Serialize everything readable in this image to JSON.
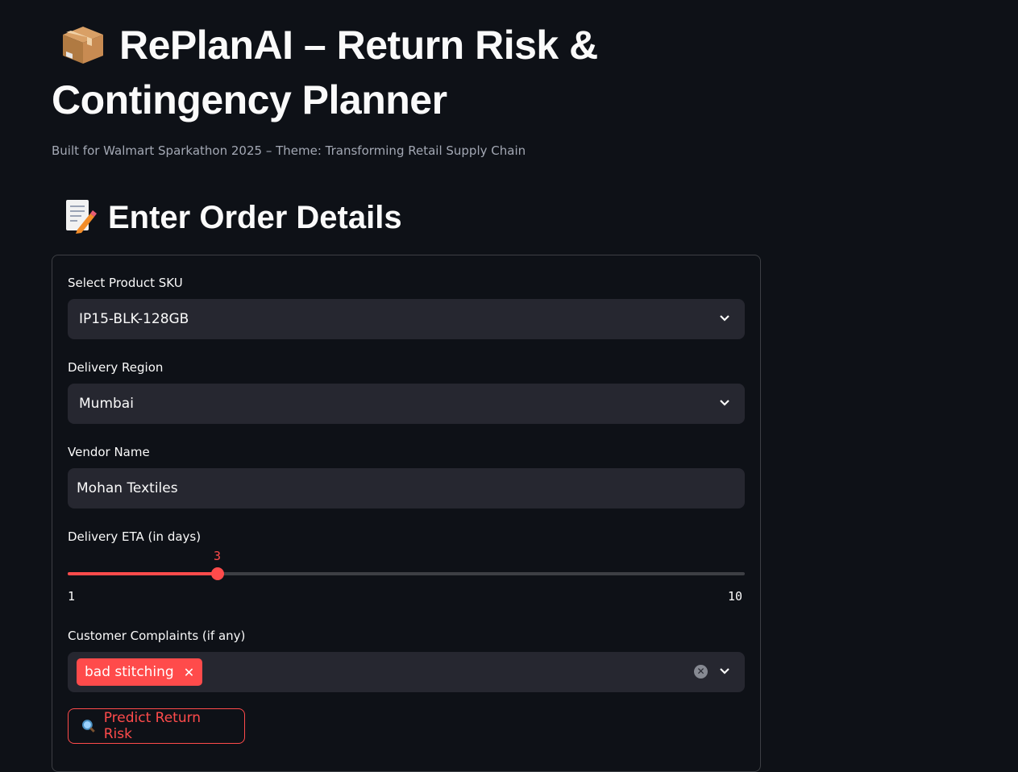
{
  "header": {
    "title": "RePlanAI – Return Risk & Contingency Planner",
    "title_icon": "package-icon",
    "caption": "Built for Walmart Sparkathon 2025 – Theme: Transforming Retail Supply Chain"
  },
  "section": {
    "heading": "Enter Order Details",
    "heading_icon": "memo-icon"
  },
  "form": {
    "sku_label": "Select Product SKU",
    "sku_value": "IP15-BLK-128GB",
    "region_label": "Delivery Region",
    "region_value": "Mumbai",
    "vendor_label": "Vendor Name",
    "vendor_value": "Mohan Textiles",
    "eta_label": "Delivery ETA (in days)",
    "eta_value": "3",
    "eta_min": "1",
    "eta_max": "10",
    "complaints_label": "Customer Complaints (if any)",
    "complaints_selected": [
      "bad stitching"
    ],
    "submit_label": "Predict Return Risk"
  },
  "colors": {
    "background": "#0e1117",
    "accent": "#ff4b4b",
    "input_bg": "#262730"
  }
}
